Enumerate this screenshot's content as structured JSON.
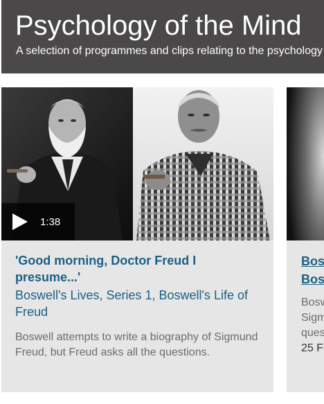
{
  "header": {
    "title": "Psychology of the Mind",
    "subtitle": "A selection of programmes and clips relating to the psychology of the mind"
  },
  "cards": [
    {
      "duration": "1:38",
      "title": "'Good morning, Doctor Freud I presume...'",
      "series": "Boswell's Lives, Series 1, Boswell's Life of Freud",
      "description": "Boswell attempts to write a biography of Sigmund Freud, but Freud asks all the questions."
    },
    {
      "title_line1": "Bos",
      "title_line2": "Bos",
      "desc_line1": "Bosw",
      "desc_line2": "Sigm",
      "desc_line3": "ques",
      "date": "25 F"
    }
  ],
  "colors": {
    "header_bg": "#4a4849",
    "card_bg": "#e6e6e6",
    "link": "#1b5f84",
    "muted_text": "#6b6b6b"
  }
}
